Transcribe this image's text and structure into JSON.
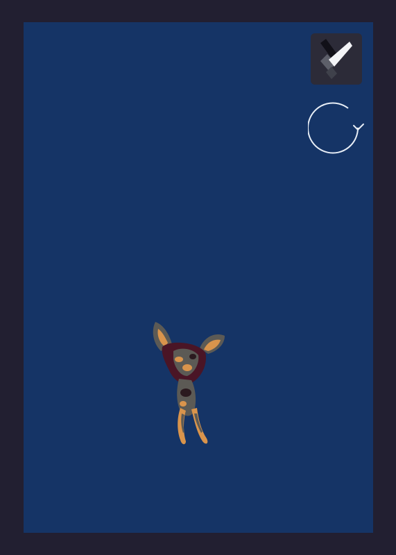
{
  "colors": {
    "frame": "#221f31",
    "canvas": "#153466",
    "tool_button_bg": "#2c2b38",
    "icon_stroke": "#e8eef6",
    "figure_tan": "#d9944c",
    "figure_gray": "#5c5a55",
    "figure_dark": "#2b1a1f",
    "figure_maroon": "#4a1526"
  },
  "toolbar": {
    "knife_tool_icon": "knife-icon",
    "rotate_icon": "rotate-clockwise-icon"
  },
  "canvas": {
    "subject": "cutout-figure"
  }
}
